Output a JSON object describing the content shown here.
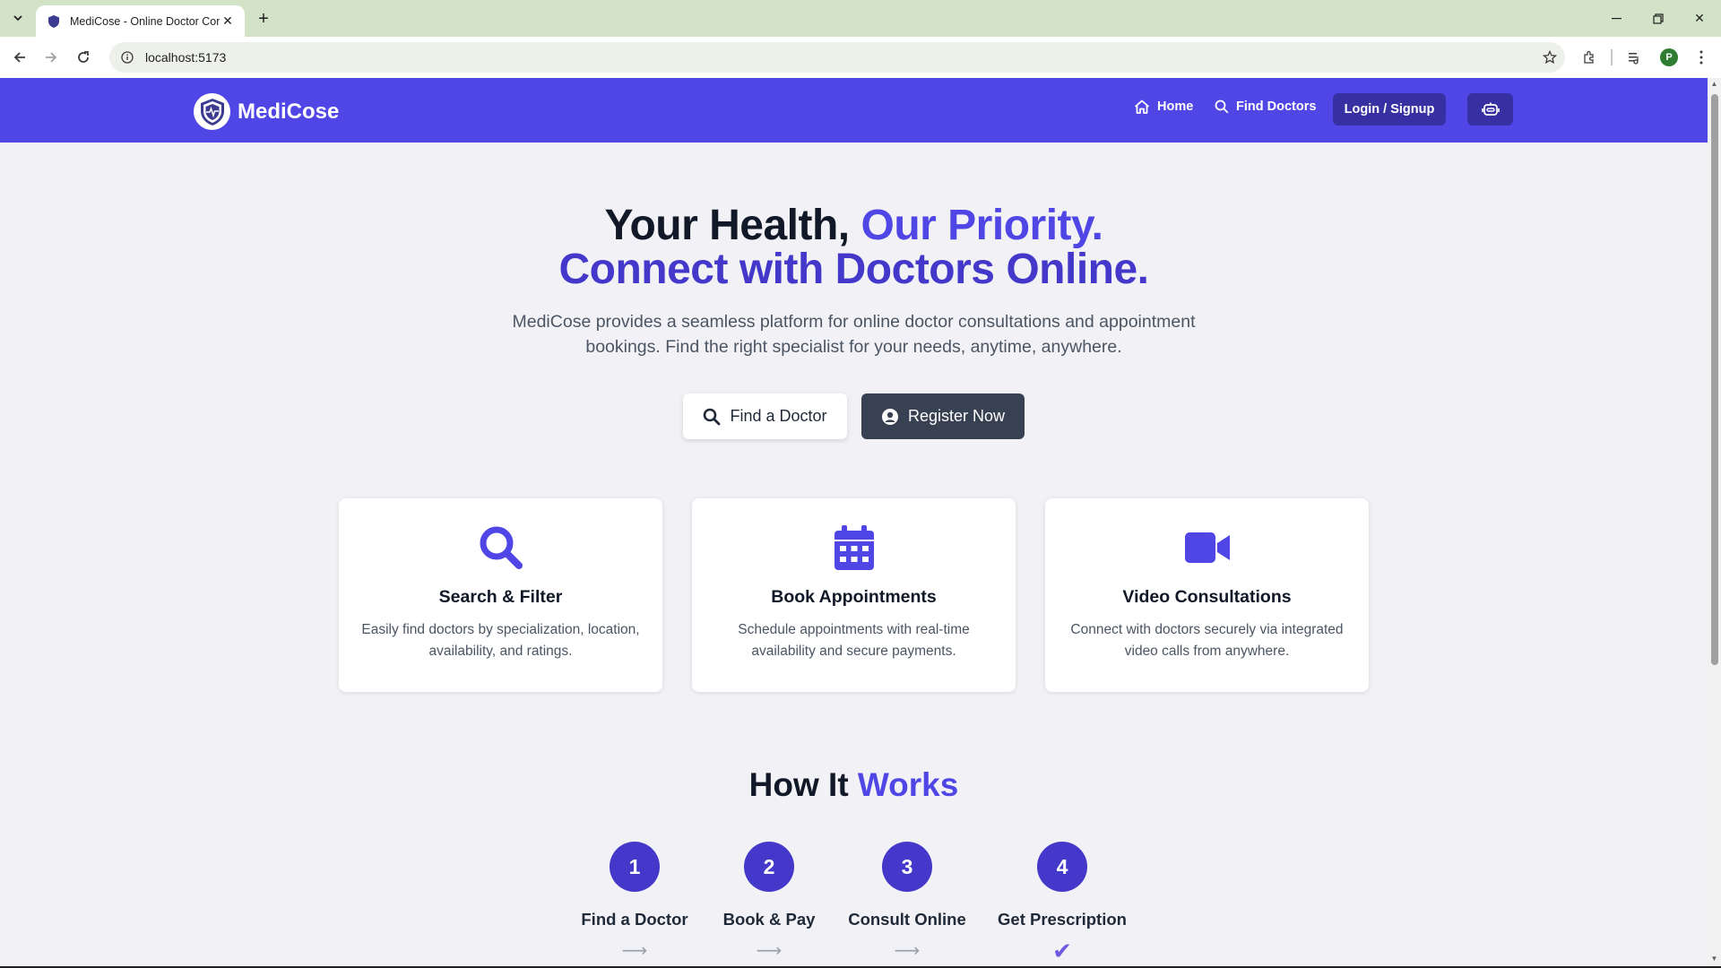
{
  "browser": {
    "tab_title": "MediCose - Online Doctor Con",
    "url": "localhost:5173",
    "profile_initial": "P"
  },
  "navbar": {
    "brand": "MediCose",
    "home": "Home",
    "find_doctors": "Find Doctors",
    "login": "Login / Signup"
  },
  "hero": {
    "title_part1": "Your Health, ",
    "title_part2": "Our Priority.",
    "title_line2": "Connect with Doctors Online.",
    "subtitle": "MediCose provides a seamless platform for online doctor consultations and appointment bookings. Find the right specialist for your needs, anytime, anywhere.",
    "find_button": "Find a Doctor",
    "register_button": "Register Now"
  },
  "features": [
    {
      "icon": "search-icon",
      "title": "Search & Filter",
      "desc": "Easily find doctors by specialization, location, availability, and ratings."
    },
    {
      "icon": "calendar-icon",
      "title": "Book Appointments",
      "desc": "Schedule appointments with real-time availability and secure payments."
    },
    {
      "icon": "video-icon",
      "title": "Video Consultations",
      "desc": "Connect with doctors securely via integrated video calls from anywhere."
    }
  ],
  "how_it_works": {
    "title_part1": "How It ",
    "title_part2": "Works",
    "steps": [
      {
        "number": "1",
        "label": "Find a Doctor",
        "arrow": "⟶"
      },
      {
        "number": "2",
        "label": "Book & Pay",
        "arrow": "⟶"
      },
      {
        "number": "3",
        "label": "Consult Online",
        "arrow": "⟶"
      },
      {
        "number": "4",
        "label": "Get Prescription",
        "arrow": "✔"
      }
    ]
  },
  "colors": {
    "primary": "#4f46e5",
    "primary_dark": "#3730a3",
    "register_button": "#374151"
  }
}
